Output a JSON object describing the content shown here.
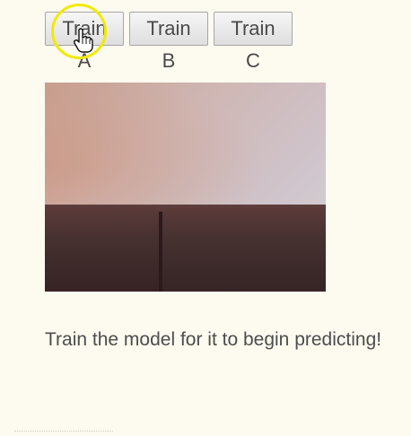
{
  "toolbar": {
    "buttons": [
      {
        "label": "Train A"
      },
      {
        "label": "Train B"
      },
      {
        "label": "Train C"
      }
    ]
  },
  "status": {
    "message": "Train the model for it to begin predicting!"
  },
  "colors": {
    "background": "#fdfaf0",
    "cursor_highlight": "#f3ea00"
  },
  "icons": {
    "cursor": "hand-pointer-icon"
  }
}
